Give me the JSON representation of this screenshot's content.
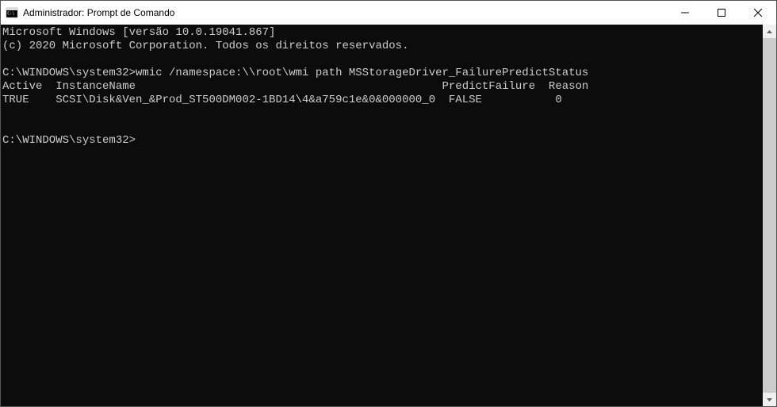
{
  "window": {
    "title": "Administrador: Prompt de Comando"
  },
  "terminal": {
    "line1": "Microsoft Windows [versão 10.0.19041.867]",
    "line2": "(c) 2020 Microsoft Corporation. Todos os direitos reservados.",
    "blank1": "",
    "line3": "C:\\WINDOWS\\system32>wmic /namespace:\\\\root\\wmi path MSStorageDriver_FailurePredictStatus",
    "line4": "Active  InstanceName                                              PredictFailure  Reason",
    "line5": "TRUE    SCSI\\Disk&Ven_&Prod_ST500DM002-1BD14\\4&a759c1e&0&000000_0  FALSE           0",
    "blank2": "",
    "blank3": "",
    "line6": "C:\\WINDOWS\\system32>"
  }
}
